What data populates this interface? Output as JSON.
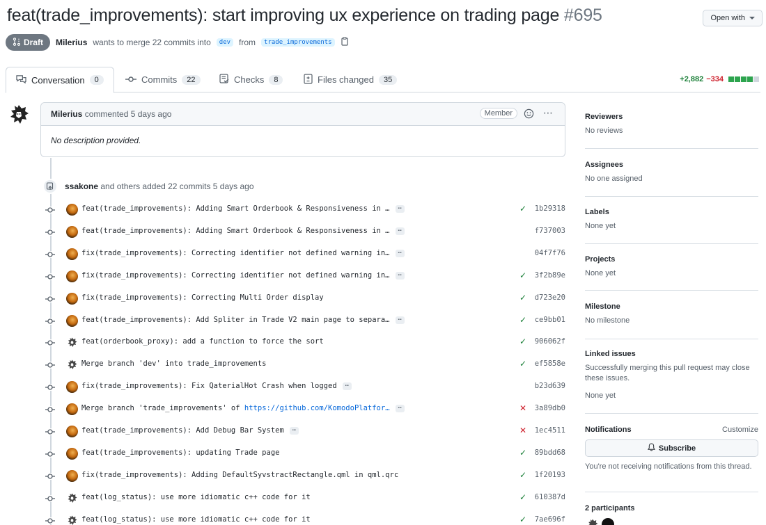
{
  "pr": {
    "title": "feat(trade_improvements): start improving ux experience on trading page",
    "number": "#695",
    "open_with": "Open with",
    "state": "Draft",
    "author": "Milerius",
    "merge_text": "wants to merge 22 commits into",
    "base_branch": "dev",
    "from_text": "from",
    "head_branch": "trade_improvements"
  },
  "tabs": [
    {
      "label": "Conversation",
      "count": "0",
      "icon": "conversation-icon"
    },
    {
      "label": "Commits",
      "count": "22",
      "icon": "commit-icon"
    },
    {
      "label": "Checks",
      "count": "8",
      "icon": "checklist-icon"
    },
    {
      "label": "Files changed",
      "count": "35",
      "icon": "file-diff-icon"
    }
  ],
  "diffstat": {
    "additions": "+2,882",
    "deletions": "−334",
    "colors": {
      "add": "#2da44e",
      "del": "#cf222e",
      "neutral": "#d0d7de"
    }
  },
  "comment": {
    "author": "Milerius",
    "action": "commented 5 days ago",
    "role": "Member",
    "body": "No description provided."
  },
  "commit_group": {
    "author": "ssakone",
    "text": "and others added 22 commits 5 days ago"
  },
  "commits": [
    {
      "message": "feat(trade_improvements): Adding Smart Orderbook & Responsiveness in …",
      "more": true,
      "status": "success",
      "sha": "1b29318",
      "avatar": "orange"
    },
    {
      "message": "feat(trade_improvements): Adding Smart Orderbook & Responsiveness in …",
      "more": true,
      "status": "none",
      "sha": "f737003",
      "avatar": "orange"
    },
    {
      "message": "fix(trade_improvements): Correcting identifier not defined warning in…",
      "more": true,
      "status": "none",
      "sha": "04f7f76",
      "avatar": "orange"
    },
    {
      "message": "fix(trade_improvements): Correcting identifier not defined warning in…",
      "more": true,
      "status": "success",
      "sha": "3f2b89e",
      "avatar": "orange"
    },
    {
      "message": "fix(trade_improvements): Correcting Multi Order display",
      "more": false,
      "status": "success",
      "sha": "d723e20",
      "avatar": "orange"
    },
    {
      "message": "feat(trade_improvements): Add Spliter in Trade V2 main page to separa…",
      "more": true,
      "status": "success",
      "sha": "ce9bb01",
      "avatar": "orange"
    },
    {
      "message": "feat(orderbook_proxy): add a function to force the sort",
      "more": false,
      "status": "success",
      "sha": "906062f",
      "avatar": "lion"
    },
    {
      "message": "Merge branch 'dev' into trade_improvements",
      "more": false,
      "status": "success",
      "sha": "ef5858e",
      "avatar": "lion"
    },
    {
      "message": "fix(trade_improvements): Fix QaterialHot Crash when logged",
      "more": true,
      "status": "none",
      "sha": "b23d639",
      "avatar": "orange"
    },
    {
      "message": "Merge branch 'trade_improvements' of ",
      "link": "https://github.com/KomodoPlatfor…",
      "more": true,
      "status": "failure",
      "sha": "3a89db0",
      "avatar": "orange"
    },
    {
      "message": "feat(trade_improvements): Add Debug Bar System",
      "more": true,
      "status": "failure",
      "sha": "1ec4511",
      "avatar": "orange"
    },
    {
      "message": "feat(trade_improvements): updating Trade page",
      "more": false,
      "status": "success",
      "sha": "89bdd68",
      "avatar": "orange"
    },
    {
      "message": "fix(trade_improvements): Adding DefaultSyvstractRectangle.qml in qml.qrc",
      "more": false,
      "status": "success",
      "sha": "1f20193",
      "avatar": "orange"
    },
    {
      "message": "feat(log_status): use more idiomatic c++ code for it",
      "more": false,
      "status": "success",
      "sha": "610387d",
      "avatar": "lion"
    },
    {
      "message": "feat(log_status): use more idiomatic c++ code for it",
      "more": false,
      "status": "success",
      "sha": "7ae696f",
      "avatar": "lion"
    }
  ],
  "sidebar": {
    "reviewers": {
      "title": "Reviewers",
      "value": "No reviews"
    },
    "assignees": {
      "title": "Assignees",
      "value": "No one assigned"
    },
    "labels": {
      "title": "Labels",
      "value": "None yet"
    },
    "projects": {
      "title": "Projects",
      "value": "None yet"
    },
    "milestone": {
      "title": "Milestone",
      "value": "No milestone"
    },
    "linked_issues": {
      "title": "Linked issues",
      "description": "Successfully merging this pull request may close these issues.",
      "value": "None yet"
    },
    "notifications": {
      "title": "Notifications",
      "customize": "Customize",
      "button": "Subscribe",
      "description": "You're not receiving notifications from this thread."
    },
    "participants": {
      "title": "2 participants"
    }
  }
}
